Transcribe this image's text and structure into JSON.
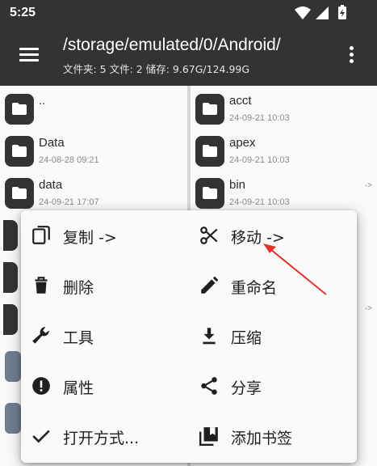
{
  "status": {
    "time": "5:25"
  },
  "header": {
    "path": "/storage/emulated/0/Android/",
    "subtitle": "文件夹: 5  文件: 2  储存: 9.67G/124.99G"
  },
  "left_pane": {
    "items": [
      {
        "name": "..",
        "date": ""
      },
      {
        "name": "Data",
        "date": "24-08-28 09:21"
      },
      {
        "name": "data",
        "date": "24-09-21 17:07"
      }
    ]
  },
  "right_pane": {
    "items": [
      {
        "name": "acct",
        "date": "24-09-21 10:03"
      },
      {
        "name": "apex",
        "date": "24-09-21 10:03"
      },
      {
        "name": "bin",
        "date": "24-09-21 10:03",
        "hint": "->"
      }
    ],
    "extra_hint": "->"
  },
  "menu": {
    "copy": "复制 ->",
    "move": "移动 ->",
    "delete": "删除",
    "rename": "重命名",
    "tools": "工具",
    "compress": "压缩",
    "properties": "属性",
    "share": "分享",
    "open_with": "打开方式...",
    "add_bookmark": "添加书签"
  },
  "colors": {
    "appbar": "#333333",
    "folder_icon": "#333333",
    "annotation_arrow": "#e5322d"
  },
  "icons": [
    "menu-icon",
    "more-vert-icon",
    "folder-icon",
    "copy-icon",
    "cut-icon",
    "delete-icon",
    "edit-icon",
    "wrench-icon",
    "download-icon",
    "info-icon",
    "share-icon",
    "check-icon",
    "bookmark-icon"
  ]
}
